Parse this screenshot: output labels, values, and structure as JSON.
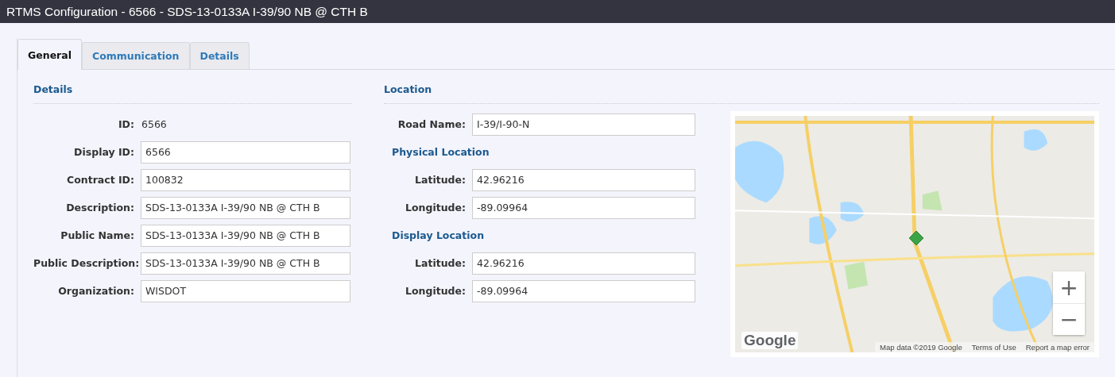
{
  "window": {
    "title": "RTMS Configuration - 6566 - SDS-13-0133A I-39/90 NB @ CTH B"
  },
  "tabs": [
    {
      "label": "General",
      "selected": true
    },
    {
      "label": "Communication",
      "selected": false
    },
    {
      "label": "Details",
      "selected": false
    }
  ],
  "details": {
    "heading": "Details",
    "fields": [
      {
        "kind": "text",
        "label": "ID:",
        "value": "6566"
      },
      {
        "kind": "input",
        "label": "Display ID:",
        "value": "6566"
      },
      {
        "kind": "input",
        "label": "Contract ID:",
        "value": "100832"
      },
      {
        "kind": "input",
        "label": "Description:",
        "value": "SDS-13-0133A I-39/90 NB @ CTH B"
      },
      {
        "kind": "input",
        "label": "Public Name:",
        "value": "SDS-13-0133A I-39/90 NB @ CTH B"
      },
      {
        "kind": "input",
        "label": "Public Description:",
        "value": "SDS-13-0133A I-39/90 NB @ CTH B"
      },
      {
        "kind": "input",
        "label": "Organization:",
        "value": "WISDOT"
      }
    ]
  },
  "location": {
    "heading": "Location",
    "items": [
      {
        "kind": "input",
        "label": "Road Name:",
        "value": "I-39/I-90-N"
      },
      {
        "kind": "heading",
        "label": "Physical Location"
      },
      {
        "kind": "input",
        "label": "Latitude:",
        "value": "42.96216"
      },
      {
        "kind": "input",
        "label": "Longitude:",
        "value": "-89.09964"
      },
      {
        "kind": "heading",
        "label": "Display Location"
      },
      {
        "kind": "input",
        "label": "Latitude:",
        "value": "42.96216"
      },
      {
        "kind": "input",
        "label": "Longitude:",
        "value": "-89.09964"
      }
    ],
    "map": {
      "kind": "picture",
      "zoom_in": "+",
      "zoom_out": "−",
      "logo": "Google",
      "attribution": [
        "Map data ©2019 Google",
        "Terms of Use",
        "Report a map error"
      ]
    }
  }
}
